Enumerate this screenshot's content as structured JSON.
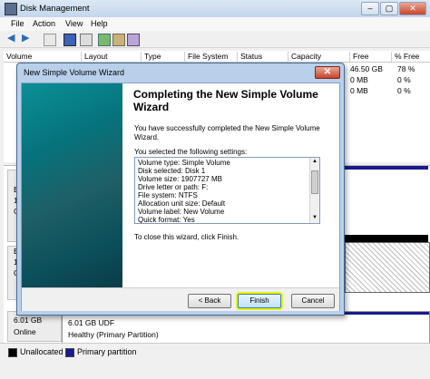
{
  "window": {
    "title": "Disk Management"
  },
  "menu": [
    "File",
    "Action",
    "View",
    "Help"
  ],
  "columns": [
    "Volume",
    "Layout",
    "Type",
    "File System",
    "Status",
    "Capacity",
    "Free Spa...",
    "% Free"
  ],
  "volume_rows": [
    {
      "free": "46.50 GB",
      "pct": "78 %"
    },
    {
      "free": "0 MB",
      "pct": "0 %"
    },
    {
      "free": "0 MB",
      "pct": "0 %"
    }
  ],
  "disk_fragments": [
    {
      "line1": "B",
      "line2": "1",
      "line3": "C"
    },
    {
      "line1": "B",
      "line2": "18",
      "line3": "C"
    }
  ],
  "dvd": {
    "size": "6.01 GB",
    "status": "Online",
    "vol_size": "6.01 GB UDF",
    "health": "Healthy (Primary Partition)"
  },
  "legend": {
    "unallocated": "Unallocated",
    "primary": "Primary partition",
    "unalloc_color": "#000000",
    "primary_color": "#1a1a8c"
  },
  "wizard": {
    "title": "New Simple Volume Wizard",
    "close": "✕",
    "heading": "Completing the New Simple Volume Wizard",
    "intro": "You have successfully completed the New Simple Volume Wizard.",
    "settings_caption": "You selected the following settings:",
    "settings": [
      "Volume type: Simple Volume",
      "Disk selected: Disk 1",
      "Volume size: 1907727 MB",
      "Drive letter or path: F:",
      "File system: NTFS",
      "Allocation unit size: Default",
      "Volume label: New Volume",
      "Quick format: Yes"
    ],
    "close_hint": "To close this wizard, click Finish.",
    "back": "< Back",
    "finish": "Finish",
    "cancel": "Cancel"
  }
}
